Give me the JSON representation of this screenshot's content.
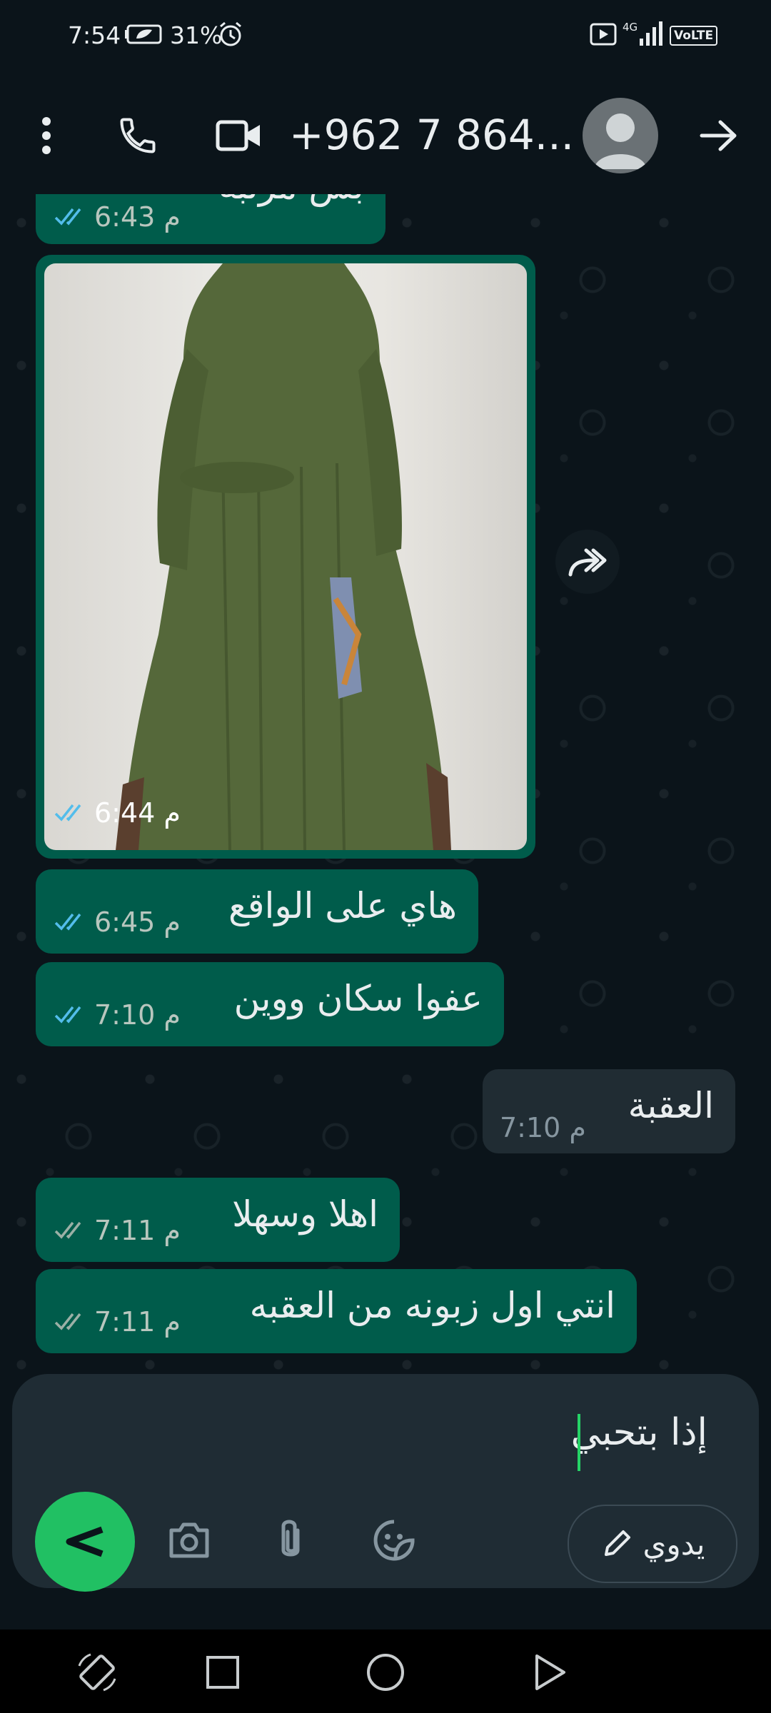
{
  "status_bar": {
    "time": "7:54",
    "battery": "31%",
    "network": "4G",
    "volte": "VoLTE"
  },
  "header": {
    "contact": "+962 7 864...",
    "icons": [
      "more-options-icon",
      "voice-call-icon",
      "video-call-icon",
      "avatar-icon",
      "back-arrow-icon"
    ]
  },
  "messages": [
    {
      "text": "بس مرتبه",
      "time": "6:43 م",
      "status": "read"
    },
    {
      "type": "image",
      "time": "6:44 م",
      "status": "read"
    },
    {
      "text": "هاي على الواقع",
      "time": "6:45 م",
      "status": "read"
    },
    {
      "text": "عفوا سكان ووين",
      "time": "7:10 م",
      "status": "read"
    },
    {
      "text": "العقبة",
      "time": "7:10 م",
      "incoming": true
    },
    {
      "text": "اهلا وسهلا",
      "time": "7:11 م",
      "status": "delivered"
    },
    {
      "text": "انتي اول زبونه من العقبه",
      "time": "7:11 م",
      "status": "delivered"
    }
  ],
  "composer": {
    "text": "إذا بتحبي",
    "manual_label": "يدوي"
  },
  "colors": {
    "outgoing": "#005c4b",
    "incoming": "#202c33",
    "accent": "#21c063",
    "read_ticks": "#53bdeb"
  }
}
